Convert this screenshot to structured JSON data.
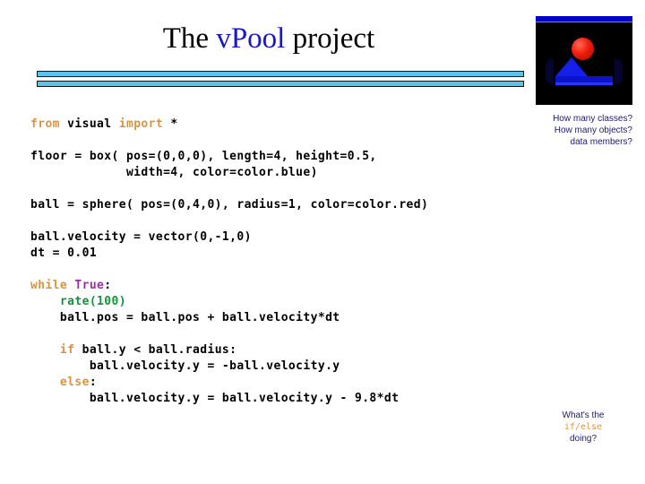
{
  "slide": {
    "title": {
      "prefix": "The ",
      "accent": "vPool",
      "suffix": " project"
    },
    "accent_color": "#1818C8",
    "rule_color": "#5BC2EA"
  },
  "thumbnail": {
    "alt": "vpython-ball-and-floor-render",
    "background_color": "#000000",
    "ball_color": "#F01B08",
    "floor_color": "#1420E8",
    "titlebar_color": "#0000CC"
  },
  "code": {
    "keyword_color": "#D9953E",
    "literal_color": "#9B2EA8",
    "function_color": "#16913C",
    "lines": [
      {
        "tokens": [
          {
            "t": "from",
            "c": "kw"
          },
          {
            "t": " visual "
          },
          {
            "t": "import",
            "c": "kw"
          },
          {
            "t": " *"
          }
        ]
      },
      {
        "blank": true
      },
      {
        "tokens": [
          {
            "t": "floor = box( pos=(0,0,0), length=4, height=0.5,"
          }
        ]
      },
      {
        "tokens": [
          {
            "t": "             width=4, color=color.blue)"
          }
        ]
      },
      {
        "blank": true
      },
      {
        "tokens": [
          {
            "t": "ball = sphere( pos=(0,4,0), radius=1, color=color.red)"
          }
        ]
      },
      {
        "blank": true
      },
      {
        "tokens": [
          {
            "t": "ball.velocity = vector(0,-1,0)"
          }
        ]
      },
      {
        "tokens": [
          {
            "t": "dt = 0.01"
          }
        ]
      },
      {
        "blank": true
      },
      {
        "tokens": [
          {
            "t": "while",
            "c": "kw"
          },
          {
            "t": " "
          },
          {
            "t": "True",
            "c": "lit"
          },
          {
            "t": ":"
          }
        ]
      },
      {
        "tokens": [
          {
            "t": "    "
          },
          {
            "t": "rate(100)",
            "c": "fn"
          }
        ]
      },
      {
        "tokens": [
          {
            "t": "    ball.pos = ball.pos + ball.velocity*dt"
          }
        ]
      },
      {
        "blank": true
      },
      {
        "tokens": [
          {
            "t": "    "
          },
          {
            "t": "if",
            "c": "kw"
          },
          {
            "t": " ball.y < ball.radius:"
          }
        ]
      },
      {
        "tokens": [
          {
            "t": "        ball.velocity.y = -ball.velocity.y"
          }
        ]
      },
      {
        "tokens": [
          {
            "t": "    "
          },
          {
            "t": "else",
            "c": "kw"
          },
          {
            "t": ":"
          }
        ]
      },
      {
        "tokens": [
          {
            "t": "        ball.velocity.y = ball.velocity.y - 9.8*dt"
          }
        ]
      }
    ]
  },
  "annotations": {
    "classes_note": {
      "line1": "How many classes?",
      "line2": "How many objects?",
      "line3": "data members?",
      "color": "#1B1B6E"
    },
    "ifelse_note": {
      "line1": "What's the",
      "code": "if/else",
      "line3": "doing?",
      "color": "#1B1B6E"
    }
  }
}
